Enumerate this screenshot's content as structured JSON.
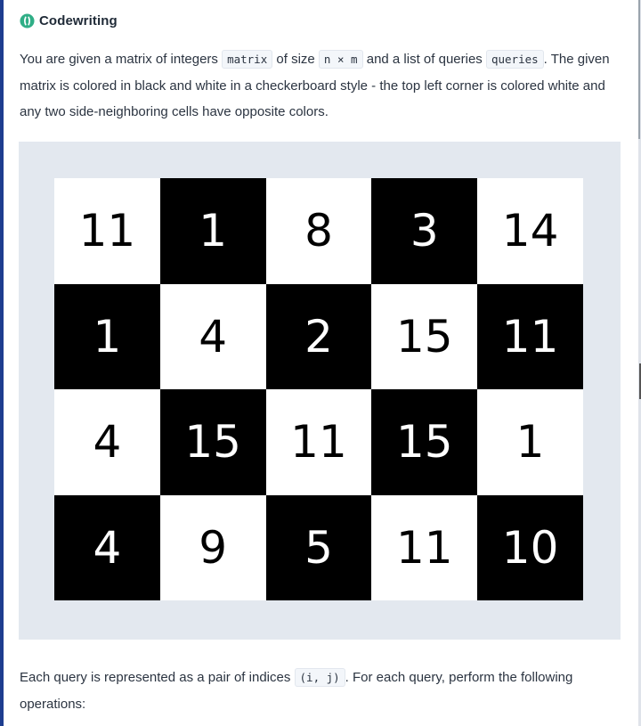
{
  "brand": {
    "name": "Codewriting",
    "icon": "codewriting-logo-icon",
    "accent_color": "#2fae86"
  },
  "intro": {
    "t1": "You are given a matrix of integers ",
    "code_matrix": "matrix",
    "t2": " of size ",
    "code_size": "n × m",
    "t3": " and a list of queries ",
    "code_queries": "queries",
    "t4": ". The given matrix is colored in black and white in a checkerboard style - the top left corner is colored white and any two side-neighboring cells have opposite colors."
  },
  "matrix": [
    [
      "11",
      "1",
      "8",
      "3",
      "14"
    ],
    [
      "1",
      "4",
      "2",
      "15",
      "11"
    ],
    [
      "4",
      "15",
      "11",
      "15",
      "1"
    ],
    [
      "4",
      "9",
      "5",
      "11",
      "10"
    ]
  ],
  "query": {
    "t1": "Each query is represented as a pair of indices ",
    "code_pair": "(i, j)",
    "t2": ". For each query, perform the following operations:"
  }
}
